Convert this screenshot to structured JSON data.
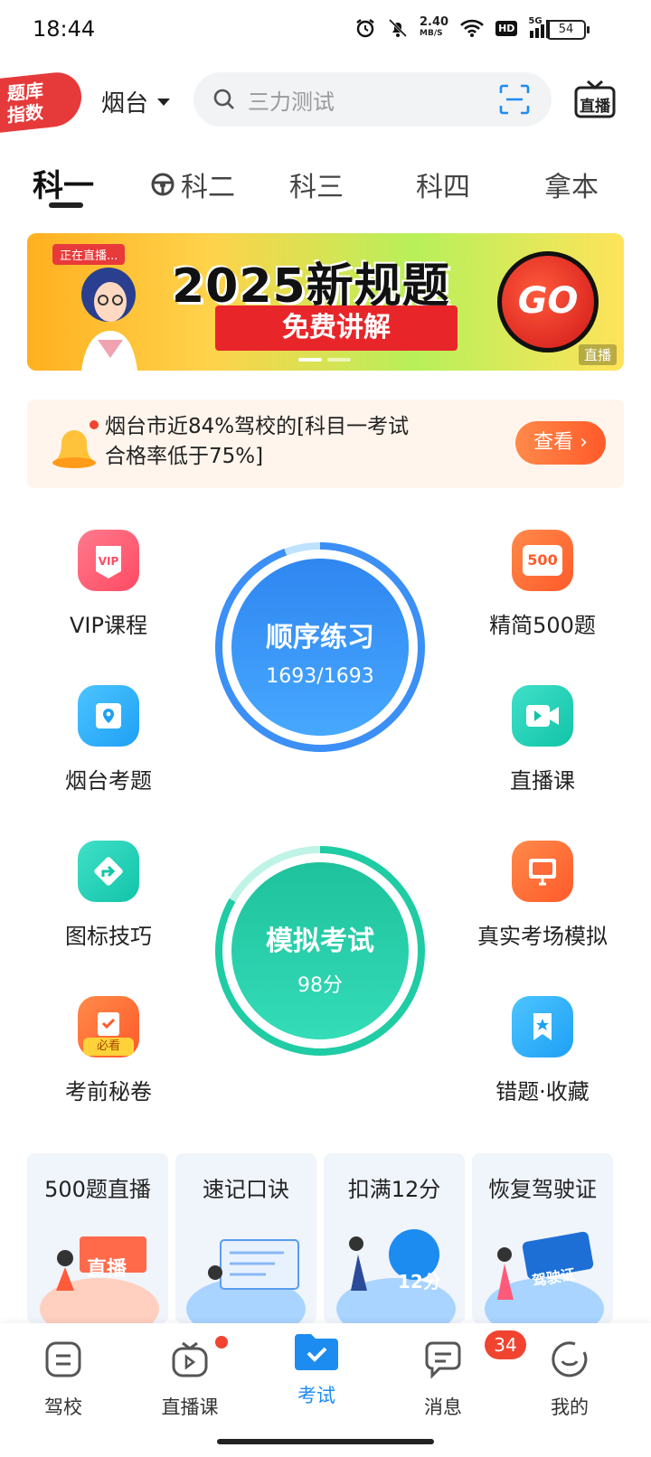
{
  "status_bar": {
    "time": "18:44",
    "net_speed": "2.40",
    "net_unit": "MB/S",
    "hd": "HD",
    "signal": "5G",
    "battery": "54"
  },
  "header": {
    "logo_line1": "题库",
    "logo_line2": "指数",
    "city": "烟台",
    "search_placeholder": "三力测试",
    "live_label": "直播"
  },
  "tabs": [
    {
      "label": "科一"
    },
    {
      "label": "科二"
    },
    {
      "label": "科三"
    },
    {
      "label": "科四"
    },
    {
      "label": "拿本"
    }
  ],
  "banner": {
    "live_tag": "正在直播...",
    "title": "2025新规题",
    "ribbon": "免费讲解",
    "go": "GO",
    "corner": "直播"
  },
  "notice": {
    "text": "烟台市近84%驾校的[科目一考试合格率低于75%]",
    "button": "查看 ›"
  },
  "features_left": [
    {
      "label": "VIP课程",
      "icon": "vip-icon"
    },
    {
      "label": "烟台考题",
      "icon": "location-icon"
    },
    {
      "label": "图标技巧",
      "icon": "turn-sign-icon"
    },
    {
      "label": "考前秘卷",
      "icon": "must-see-icon",
      "badge": "必看"
    }
  ],
  "features_right": [
    {
      "label": "精简500题",
      "icon": "500-icon",
      "badge": "500"
    },
    {
      "label": "直播课",
      "icon": "video-icon"
    },
    {
      "label": "真实考场模拟",
      "icon": "monitor-icon"
    },
    {
      "label": "错题·收藏",
      "icon": "bookmark-icon"
    }
  ],
  "practice": {
    "title": "顺序练习",
    "progress": "1693/1693"
  },
  "exam": {
    "title": "模拟考试",
    "score": "98分"
  },
  "cards": [
    {
      "title": "500题直播",
      "art_text": "直播"
    },
    {
      "title": "速记口诀"
    },
    {
      "title": "扣满12分",
      "art_text": "12分"
    },
    {
      "title": "恢复驾驶证",
      "art_text": "驾驶证"
    }
  ],
  "nav": [
    {
      "label": "驾校"
    },
    {
      "label": "直播课"
    },
    {
      "label": "考试"
    },
    {
      "label": "消息",
      "badge": "34"
    },
    {
      "label": "我的"
    }
  ],
  "colors": {
    "accent": "#1d8cf0",
    "practice": "#3b8ff5",
    "exam": "#1fcca4",
    "badge": "#f04430"
  }
}
